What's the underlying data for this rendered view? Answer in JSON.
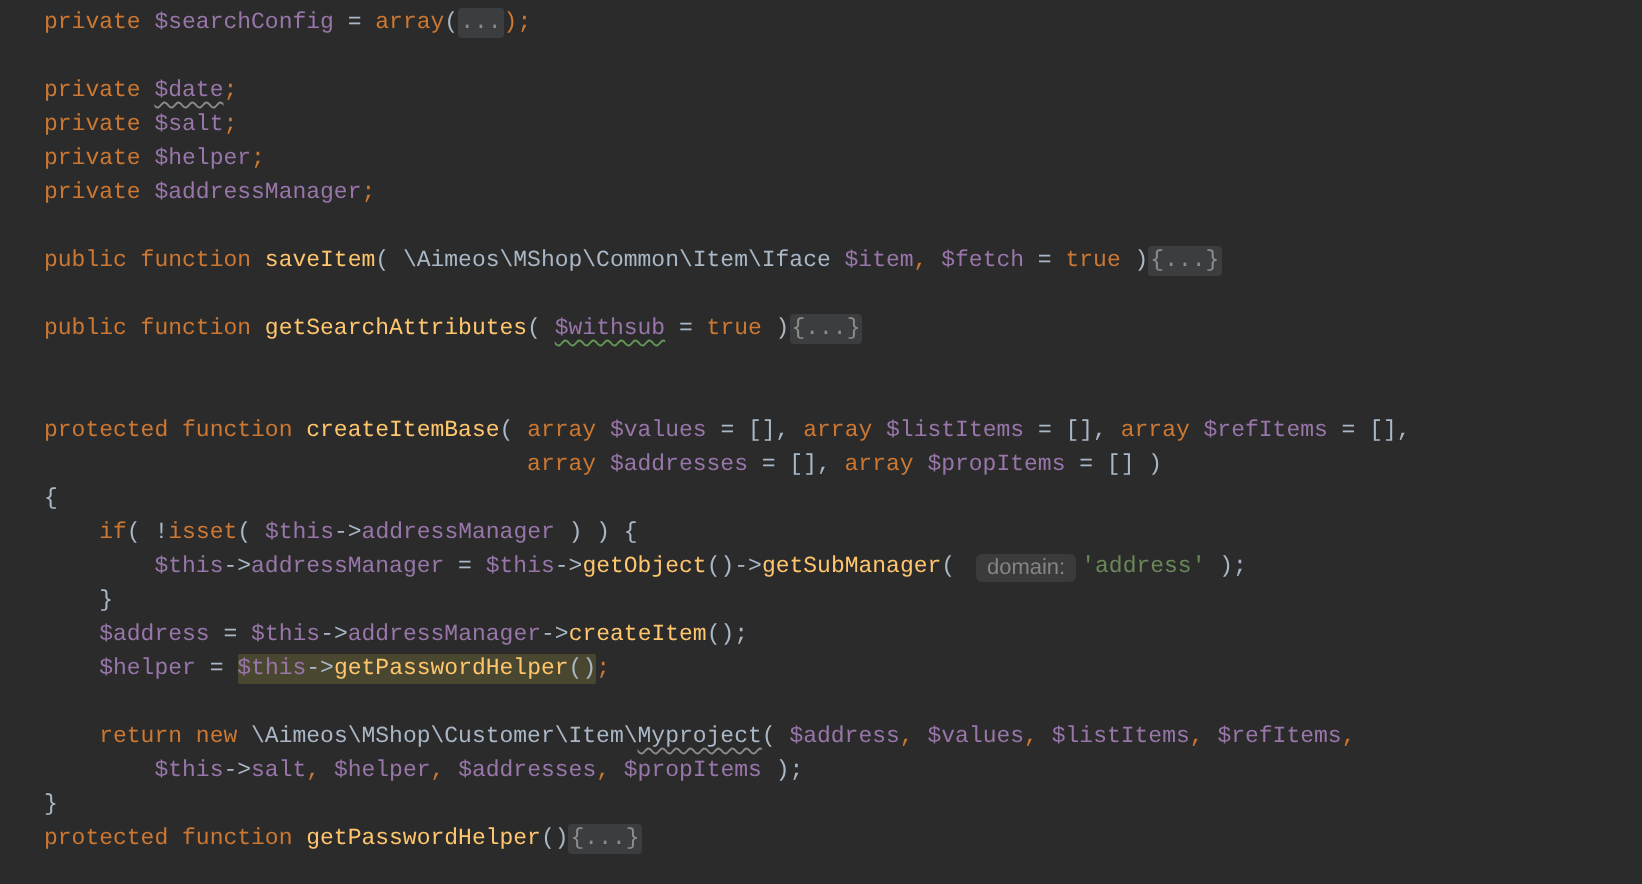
{
  "editor": {
    "lines": [
      {
        "kind": "code",
        "segments": [
          {
            "kind": "code",
            "tokens": [
              {
                "t": "private ",
                "kind": "kw"
              },
              {
                "t": "$searchConfig",
                "kind": "var"
              },
              {
                "t": " = ",
                "kind": "plain"
              },
              {
                "t": "array",
                "kind": "kw"
              },
              {
                "t": "(",
                "kind": "plain"
              }
            ]
          },
          {
            "kind": "fold",
            "text": "..."
          },
          {
            "kind": "code",
            "tokens": [
              {
                "t": ");",
                "kind": "kw"
              }
            ]
          }
        ]
      },
      {
        "kind": "blank"
      },
      {
        "kind": "code",
        "segments": [
          {
            "kind": "code",
            "tokens": [
              {
                "t": "private ",
                "kind": "kw"
              },
              {
                "t": "$date",
                "kind": "var",
                "weak_warning": true
              },
              {
                "t": ";",
                "kind": "kw"
              }
            ]
          }
        ]
      },
      {
        "kind": "code",
        "segments": [
          {
            "kind": "code",
            "tokens": [
              {
                "t": "private ",
                "kind": "kw"
              },
              {
                "t": "$salt",
                "kind": "var"
              },
              {
                "t": ";",
                "kind": "kw"
              }
            ]
          }
        ]
      },
      {
        "kind": "code",
        "segments": [
          {
            "kind": "code",
            "tokens": [
              {
                "t": "private ",
                "kind": "kw"
              },
              {
                "t": "$helper",
                "kind": "var"
              },
              {
                "t": ";",
                "kind": "kw"
              }
            ]
          }
        ]
      },
      {
        "kind": "code",
        "segments": [
          {
            "kind": "code",
            "tokens": [
              {
                "t": "private ",
                "kind": "kw"
              },
              {
                "t": "$addressManager",
                "kind": "var"
              },
              {
                "t": ";",
                "kind": "kw"
              }
            ]
          }
        ]
      },
      {
        "kind": "blank"
      },
      {
        "kind": "code",
        "segments": [
          {
            "kind": "code",
            "tokens": [
              {
                "t": "public function ",
                "kind": "kw"
              },
              {
                "t": "saveItem",
                "kind": "fn"
              },
              {
                "t": "( \\Aimeos\\MShop\\Common\\Item\\Iface ",
                "kind": "plain"
              },
              {
                "t": "$item",
                "kind": "var"
              },
              {
                "t": ", ",
                "kind": "kw"
              },
              {
                "t": "$fetch",
                "kind": "var"
              },
              {
                "t": " = ",
                "kind": "plain"
              },
              {
                "t": "true",
                "kind": "kw"
              },
              {
                "t": " )",
                "kind": "plain"
              }
            ]
          },
          {
            "kind": "fold",
            "text": "{...}"
          }
        ]
      },
      {
        "kind": "blank"
      },
      {
        "kind": "code",
        "segments": [
          {
            "kind": "code",
            "tokens": [
              {
                "t": "public function ",
                "kind": "kw"
              },
              {
                "t": "getSearchAttributes",
                "kind": "fn"
              },
              {
                "t": "( ",
                "kind": "plain"
              },
              {
                "t": "$withsub",
                "kind": "var",
                "typo": true
              },
              {
                "t": " = ",
                "kind": "plain"
              },
              {
                "t": "true",
                "kind": "kw"
              },
              {
                "t": " )",
                "kind": "plain"
              }
            ]
          },
          {
            "kind": "fold",
            "text": "{...}"
          }
        ]
      },
      {
        "kind": "blank"
      },
      {
        "kind": "blank"
      },
      {
        "kind": "code",
        "segments": [
          {
            "kind": "code",
            "tokens": [
              {
                "t": "protected function ",
                "kind": "kw"
              },
              {
                "t": "createItemBase",
                "kind": "fn"
              },
              {
                "t": "( ",
                "kind": "plain"
              },
              {
                "t": "array ",
                "kind": "kw"
              },
              {
                "t": "$values",
                "kind": "var"
              },
              {
                "t": " = [], ",
                "kind": "plain"
              },
              {
                "t": "array ",
                "kind": "kw"
              },
              {
                "t": "$listItems",
                "kind": "var"
              },
              {
                "t": " = [], ",
                "kind": "plain"
              },
              {
                "t": "array ",
                "kind": "kw"
              },
              {
                "t": "$refItems",
                "kind": "var"
              },
              {
                "t": " = [],",
                "kind": "plain"
              }
            ]
          }
        ]
      },
      {
        "kind": "code",
        "segments": [
          {
            "kind": "code",
            "tokens": [
              {
                "t": "                                   array ",
                "kind": "kw"
              },
              {
                "t": "$addresses",
                "kind": "var"
              },
              {
                "t": " = [], ",
                "kind": "plain"
              },
              {
                "t": "array ",
                "kind": "kw"
              },
              {
                "t": "$propItems",
                "kind": "var"
              },
              {
                "t": " = [] )",
                "kind": "plain"
              }
            ]
          }
        ]
      },
      {
        "kind": "code",
        "segments": [
          {
            "kind": "code",
            "tokens": [
              {
                "t": "{",
                "kind": "plain"
              }
            ]
          }
        ]
      },
      {
        "kind": "code",
        "segments": [
          {
            "kind": "code",
            "tokens": [
              {
                "t": "    if",
                "kind": "kw"
              },
              {
                "t": "( !",
                "kind": "plain"
              },
              {
                "t": "isset",
                "kind": "kw"
              },
              {
                "t": "( ",
                "kind": "plain"
              },
              {
                "t": "$this",
                "kind": "var"
              },
              {
                "t": "->",
                "kind": "plain"
              },
              {
                "t": "addressManager",
                "kind": "var"
              },
              {
                "t": " ) ) {",
                "kind": "plain"
              }
            ]
          }
        ]
      },
      {
        "kind": "code",
        "segments": [
          {
            "kind": "code",
            "tokens": [
              {
                "t": "        $this",
                "kind": "var"
              },
              {
                "t": "->",
                "kind": "plain"
              },
              {
                "t": "addressManager",
                "kind": "var"
              },
              {
                "t": " = ",
                "kind": "plain"
              },
              {
                "t": "$this",
                "kind": "var"
              },
              {
                "t": "->",
                "kind": "plain"
              },
              {
                "t": "getObject",
                "kind": "fn"
              },
              {
                "t": "()->",
                "kind": "plain"
              },
              {
                "t": "getSubManager",
                "kind": "fn"
              },
              {
                "t": "( ",
                "kind": "plain"
              }
            ]
          },
          {
            "kind": "hint",
            "text": "domain:"
          },
          {
            "kind": "code",
            "tokens": [
              {
                "t": "'address'",
                "kind": "str"
              },
              {
                "t": " );",
                "kind": "plain"
              }
            ]
          }
        ]
      },
      {
        "kind": "code",
        "segments": [
          {
            "kind": "code",
            "tokens": [
              {
                "t": "    }",
                "kind": "plain"
              }
            ]
          }
        ]
      },
      {
        "kind": "code",
        "segments": [
          {
            "kind": "code",
            "tokens": [
              {
                "t": "    $address",
                "kind": "var"
              },
              {
                "t": " = ",
                "kind": "plain"
              },
              {
                "t": "$this",
                "kind": "var"
              },
              {
                "t": "->",
                "kind": "plain"
              },
              {
                "t": "addressManager",
                "kind": "var"
              },
              {
                "t": "->",
                "kind": "plain"
              },
              {
                "t": "createItem",
                "kind": "fn"
              },
              {
                "t": "();",
                "kind": "plain"
              }
            ]
          }
        ]
      },
      {
        "kind": "code",
        "segments": [
          {
            "kind": "code",
            "tokens": [
              {
                "t": "    $helper",
                "kind": "var"
              },
              {
                "t": " = ",
                "kind": "plain"
              }
            ]
          },
          {
            "kind": "highlight",
            "tokens": [
              {
                "t": "$this",
                "kind": "var"
              },
              {
                "t": "->",
                "kind": "plain"
              },
              {
                "t": "getPasswordHelper",
                "kind": "fn"
              },
              {
                "t": "()",
                "kind": "plain"
              }
            ]
          },
          {
            "kind": "code",
            "tokens": [
              {
                "t": ";",
                "kind": "kw"
              }
            ]
          }
        ]
      },
      {
        "kind": "blank"
      },
      {
        "kind": "code",
        "segments": [
          {
            "kind": "code",
            "tokens": [
              {
                "t": "    return new ",
                "kind": "kw"
              },
              {
                "t": "\\Aimeos\\MShop\\Customer\\Item\\",
                "kind": "plain"
              },
              {
                "t": "Myproject",
                "kind": "plain",
                "weak_warning": true
              },
              {
                "t": "( ",
                "kind": "plain"
              },
              {
                "t": "$address",
                "kind": "var"
              },
              {
                "t": ", ",
                "kind": "kw"
              },
              {
                "t": "$values",
                "kind": "var"
              },
              {
                "t": ", ",
                "kind": "kw"
              },
              {
                "t": "$listItems",
                "kind": "var"
              },
              {
                "t": ", ",
                "kind": "kw"
              },
              {
                "t": "$refItems",
                "kind": "var"
              },
              {
                "t": ",",
                "kind": "kw"
              }
            ]
          }
        ]
      },
      {
        "kind": "code",
        "segments": [
          {
            "kind": "code",
            "tokens": [
              {
                "t": "        $this",
                "kind": "var"
              },
              {
                "t": "->",
                "kind": "plain"
              },
              {
                "t": "salt",
                "kind": "var"
              },
              {
                "t": ", ",
                "kind": "kw"
              },
              {
                "t": "$helper",
                "kind": "var"
              },
              {
                "t": ", ",
                "kind": "kw"
              },
              {
                "t": "$addresses",
                "kind": "var"
              },
              {
                "t": ", ",
                "kind": "kw"
              },
              {
                "t": "$propItems",
                "kind": "var"
              },
              {
                "t": " );",
                "kind": "plain"
              }
            ]
          }
        ]
      },
      {
        "kind": "code",
        "segments": [
          {
            "kind": "code",
            "tokens": [
              {
                "t": "}",
                "kind": "plain"
              }
            ]
          }
        ]
      },
      {
        "kind": "code",
        "segments": [
          {
            "kind": "code",
            "tokens": [
              {
                "t": "protected function ",
                "kind": "kw"
              },
              {
                "t": "getPasswordHelper",
                "kind": "fn"
              },
              {
                "t": "()",
                "kind": "plain"
              }
            ]
          },
          {
            "kind": "fold",
            "text": "{...}"
          }
        ]
      }
    ]
  }
}
